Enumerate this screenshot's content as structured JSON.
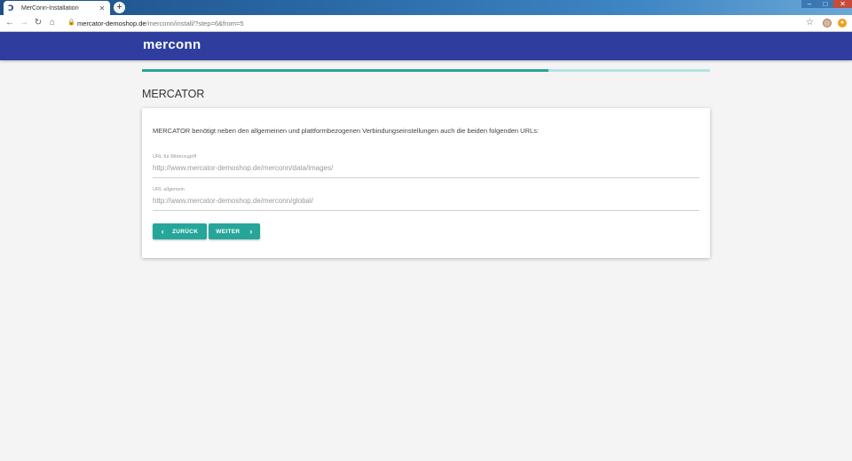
{
  "browser": {
    "tab_title": "MerConn-Installation",
    "tab_icon": "merconn-favicon",
    "url_host": "mercator-demoshop.de",
    "url_path": "/merconn/install/?step=6&from=5"
  },
  "header": {
    "logo_text": "merconn",
    "bg_color": "#2f3e9e"
  },
  "progress": {
    "value_percent": 71.5,
    "fill_color": "#26a69a",
    "track_color": "#b2e3e4"
  },
  "page": {
    "title": "MERCATOR"
  },
  "card": {
    "intro": "MERCATOR benötigt neben den allgemeinen und plattformbezogenen Verbindungseinstellungen auch die beiden folgenden URLs:",
    "fields": [
      {
        "label": "URL für Bilderzugriff",
        "placeholder": "http://www.mercator-demoshop.de/merconn/data/images/"
      },
      {
        "label": "URL allgemein",
        "placeholder": "http://www.mercator-demoshop.de/merconn/global/"
      }
    ],
    "buttons": {
      "back": "ZURÜCK",
      "next": "WEITER"
    },
    "accent_color": "#26a69a"
  }
}
